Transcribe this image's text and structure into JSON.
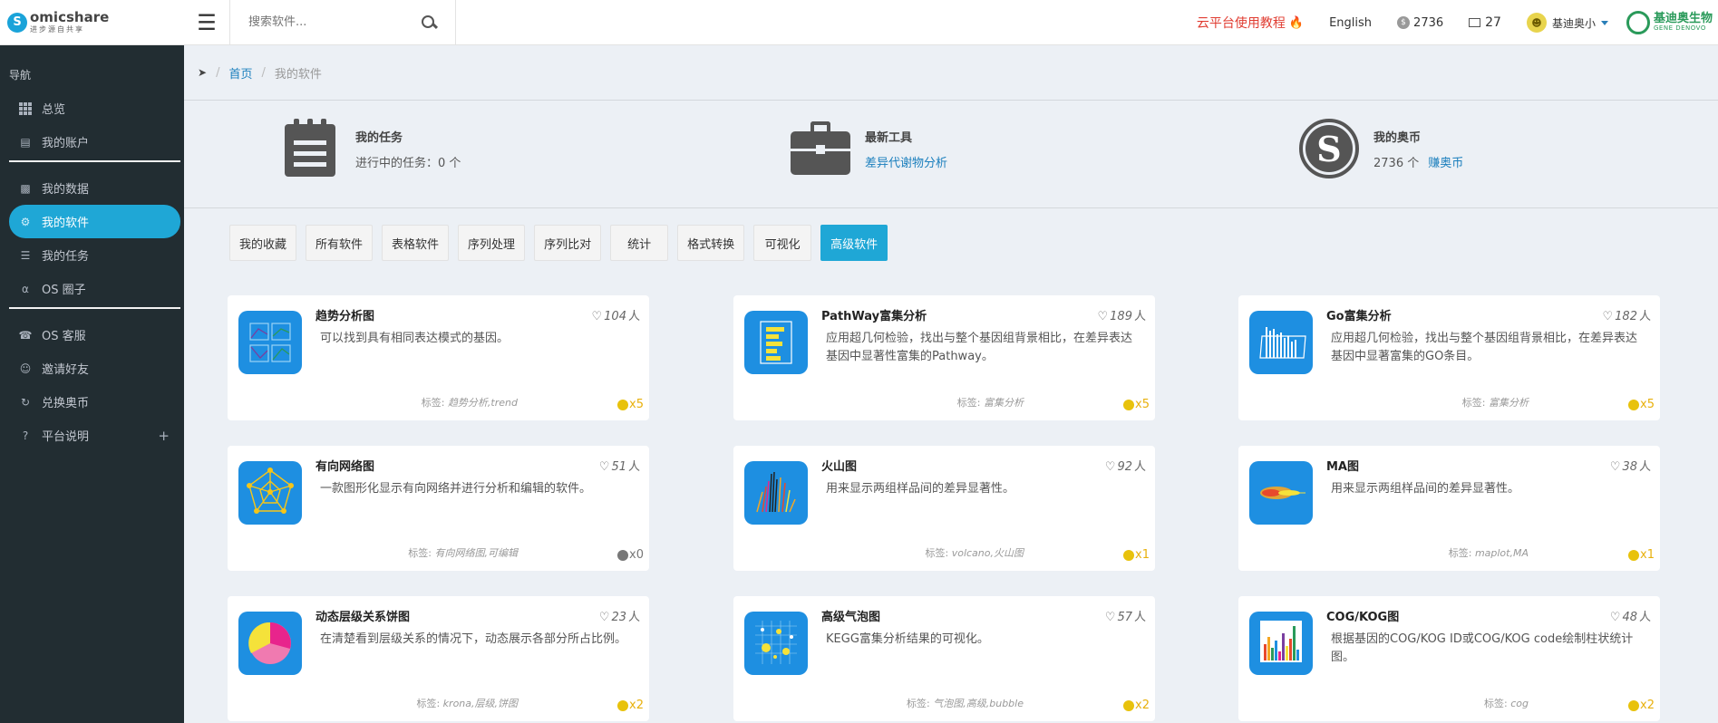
{
  "header": {
    "logo_name": "omicshare",
    "logo_tagline": "进步源自共享",
    "logo_mark": "S",
    "search_placeholder": "搜索软件...",
    "tutorial_label": "云平台使用教程",
    "language_label": "English",
    "coin_count": "2736",
    "mail_count": "27",
    "username": "基迪奥小",
    "brand_cn": "基迪奥生物",
    "brand_en": "GENE DENOVO"
  },
  "sidebar": {
    "heading": "导航",
    "items": [
      {
        "label": "总览"
      },
      {
        "label": "我的账户"
      },
      {
        "label": "我的数据"
      },
      {
        "label": "我的软件"
      },
      {
        "label": "我的任务"
      },
      {
        "label": "OS 圈子"
      },
      {
        "label": "OS 客服"
      },
      {
        "label": "邀请好友"
      },
      {
        "label": "兑换奥币"
      },
      {
        "label": "平台说明"
      }
    ]
  },
  "breadcrumb": {
    "home": "首页",
    "current": "我的软件"
  },
  "stats": {
    "tasks": {
      "title": "我的任务",
      "sub": "进行中的任务：0 个"
    },
    "tools": {
      "title": "最新工具",
      "link": "差异代谢物分析"
    },
    "coins": {
      "title": "我的奥币",
      "sub": "2736 个",
      "link": "赚奥币"
    }
  },
  "filters": [
    "我的收藏",
    "所有软件",
    "表格软件",
    "序列处理",
    "序列比对",
    "统计",
    "格式转换",
    "可视化",
    "高级软件"
  ],
  "active_filter": "高级软件",
  "cards": [
    {
      "title": "趋势分析图",
      "likes": "104",
      "desc": "可以找到具有相同表达模式的基因。",
      "tag_prefix": "标签:",
      "tags": "趋势分析,trend",
      "cost": "x5",
      "icon": "trend-chart-icon"
    },
    {
      "title": "PathWay富集分析",
      "likes": "189",
      "desc": "应用超几何检验，找出与整个基因组背景相比，在差异表达基因中显著性富集的Pathway。",
      "tag_prefix": "标签:",
      "tags": "富集分析",
      "cost": "x5",
      "icon": "pathway-bar-icon"
    },
    {
      "title": "Go富集分析",
      "likes": "182",
      "desc": "应用超几何检验，找出与整个基因组背景相比，在差异表达基因中显著富集的GO条目。",
      "tag_prefix": "标签:",
      "tags": "富集分析",
      "cost": "x5",
      "icon": "go-bar-icon"
    },
    {
      "title": "有向网络图",
      "likes": "51",
      "desc": "一款图形化显示有向网络并进行分析和编辑的软件。",
      "tag_prefix": "标签:",
      "tags": "有向网络图,可编辑",
      "cost": "x0",
      "icon": "network-icon"
    },
    {
      "title": "火山图",
      "likes": "92",
      "desc": "用来显示两组样品间的差异显著性。",
      "tag_prefix": "标签:",
      "tags": "volcano,火山图",
      "cost": "x1",
      "icon": "volcano-plot-icon"
    },
    {
      "title": "MA图",
      "likes": "38",
      "desc": "用来显示两组样品间的差异显著性。",
      "tag_prefix": "标签:",
      "tags": "maplot,MA",
      "cost": "x1",
      "icon": "ma-plot-icon"
    },
    {
      "title": "动态层级关系饼图",
      "likes": "23",
      "desc": "在清楚看到层级关系的情况下，动态展示各部分所占比例。",
      "tag_prefix": "标签:",
      "tags": "krona,层级,饼图",
      "cost": "x2",
      "icon": "pie-chart-icon"
    },
    {
      "title": "高级气泡图",
      "likes": "57",
      "desc": "KEGG富集分析结果的可视化。",
      "tag_prefix": "标签:",
      "tags": "气泡图,高级,bubble",
      "cost": "x2",
      "icon": "bubble-chart-icon"
    },
    {
      "title": "COG/KOG图",
      "likes": "48",
      "desc": "根据基因的COG/KOG ID或COG/KOG code绘制柱状统计图。",
      "tag_prefix": "标签:",
      "tags": "cog",
      "cost": "x2",
      "icon": "cog-bar-icon"
    }
  ],
  "likes_unit": "人",
  "colors": {
    "accent": "#1fa7d6",
    "sidebar_bg": "#222d32",
    "link": "#1b7fbd",
    "coin": "#e8c20c",
    "tutorial": "#e03c31"
  }
}
